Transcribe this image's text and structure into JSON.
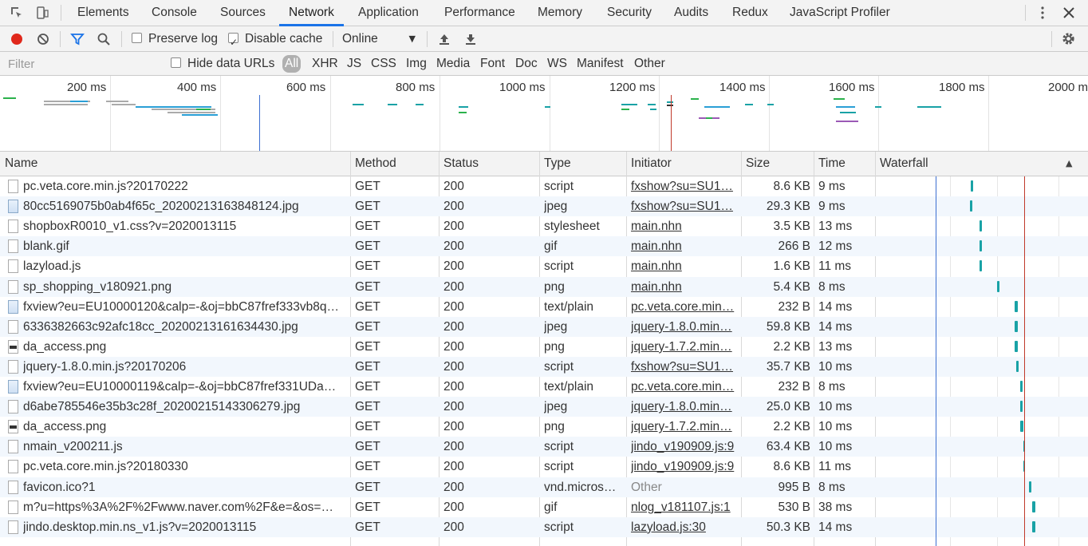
{
  "tabs": [
    "Elements",
    "Console",
    "Sources",
    "Network",
    "Application",
    "Performance",
    "Memory",
    "Security",
    "Audits",
    "Redux",
    "JavaScript Profiler"
  ],
  "active_tab": "Network",
  "toolbar": {
    "preserve_log": "Preserve log",
    "disable_cache": "Disable cache",
    "throttle": "Online",
    "preserve_log_checked": false,
    "disable_cache_checked": true
  },
  "filter": {
    "placeholder": "Filter",
    "hide_data_urls": "Hide data URLs",
    "types": [
      "All",
      "XHR",
      "JS",
      "CSS",
      "Img",
      "Media",
      "Font",
      "Doc",
      "WS",
      "Manifest",
      "Other"
    ],
    "selected_type": "All"
  },
  "overview": {
    "ticks": [
      "200 ms",
      "400 ms",
      "600 ms",
      "800 ms",
      "1000 ms",
      "1200 ms",
      "1400 ms",
      "1600 ms",
      "1800 ms",
      "2000 ms"
    ]
  },
  "columns": {
    "name": "Name",
    "method": "Method",
    "status": "Status",
    "type": "Type",
    "initiator": "Initiator",
    "size": "Size",
    "time": "Time",
    "waterfall": "Waterfall"
  },
  "requests": [
    {
      "name": "pc.veta.core.min.js?20170222",
      "method": "GET",
      "status": "200",
      "type": "script",
      "initiator": "fxshow?su=SU1…",
      "size": "8.6 KB",
      "time": "9 ms",
      "icon": "file"
    },
    {
      "name": "80cc5169075b0ab4f65c_20200213163848124.jpg",
      "method": "GET",
      "status": "200",
      "type": "jpeg",
      "initiator": "fxshow?su=SU1…",
      "size": "29.3 KB",
      "time": "9 ms",
      "icon": "img"
    },
    {
      "name": "shopboxR0010_v1.css?v=2020013115",
      "method": "GET",
      "status": "200",
      "type": "stylesheet",
      "initiator": "main.nhn",
      "size": "3.5 KB",
      "time": "13 ms",
      "icon": "file"
    },
    {
      "name": "blank.gif",
      "method": "GET",
      "status": "200",
      "type": "gif",
      "initiator": "main.nhn",
      "size": "266 B",
      "time": "12 ms",
      "icon": "file"
    },
    {
      "name": "lazyload.js",
      "method": "GET",
      "status": "200",
      "type": "script",
      "initiator": "main.nhn",
      "size": "1.6 KB",
      "time": "11 ms",
      "icon": "file"
    },
    {
      "name": "sp_shopping_v180921.png",
      "method": "GET",
      "status": "200",
      "type": "png",
      "initiator": "main.nhn",
      "size": "5.4 KB",
      "time": "8 ms",
      "icon": "file"
    },
    {
      "name": "fxview?eu=EU10000120&calp=-&oj=bbC87fref333vb8q…",
      "method": "GET",
      "status": "200",
      "type": "text/plain",
      "initiator": "pc.veta.core.min…",
      "size": "232 B",
      "time": "14 ms",
      "icon": "img"
    },
    {
      "name": "6336382663c92afc18cc_20200213161634430.jpg",
      "method": "GET",
      "status": "200",
      "type": "jpeg",
      "initiator": "jquery-1.8.0.min…",
      "size": "59.8 KB",
      "time": "14 ms",
      "icon": "file"
    },
    {
      "name": "da_access.png",
      "method": "GET",
      "status": "200",
      "type": "png",
      "initiator": "jquery-1.7.2.min…",
      "size": "2.2 KB",
      "time": "13 ms",
      "icon": "dark"
    },
    {
      "name": "jquery-1.8.0.min.js?20170206",
      "method": "GET",
      "status": "200",
      "type": "script",
      "initiator": "fxshow?su=SU1…",
      "size": "35.7 KB",
      "time": "10 ms",
      "icon": "file"
    },
    {
      "name": "fxview?eu=EU10000119&calp=-&oj=bbC87fref331UDa…",
      "method": "GET",
      "status": "200",
      "type": "text/plain",
      "initiator": "pc.veta.core.min…",
      "size": "232 B",
      "time": "8 ms",
      "icon": "img"
    },
    {
      "name": "d6abe785546e35b3c28f_20200215143306279.jpg",
      "method": "GET",
      "status": "200",
      "type": "jpeg",
      "initiator": "jquery-1.8.0.min…",
      "size": "25.0 KB",
      "time": "10 ms",
      "icon": "file"
    },
    {
      "name": "da_access.png",
      "method": "GET",
      "status": "200",
      "type": "png",
      "initiator": "jquery-1.7.2.min…",
      "size": "2.2 KB",
      "time": "10 ms",
      "icon": "dark"
    },
    {
      "name": "nmain_v200211.js",
      "method": "GET",
      "status": "200",
      "type": "script",
      "initiator": "jindo_v190909.js:9",
      "size": "63.4 KB",
      "time": "10 ms",
      "icon": "file"
    },
    {
      "name": "pc.veta.core.min.js?20180330",
      "method": "GET",
      "status": "200",
      "type": "script",
      "initiator": "jindo_v190909.js:9",
      "size": "8.6 KB",
      "time": "11 ms",
      "icon": "file"
    },
    {
      "name": "favicon.ico?1",
      "method": "GET",
      "status": "200",
      "type": "vnd.micros…",
      "initiator": "Other",
      "size": "995 B",
      "time": "8 ms",
      "icon": "file"
    },
    {
      "name": "m?u=https%3A%2F%2Fwww.naver.com%2F&e=&os=…",
      "method": "GET",
      "status": "200",
      "type": "gif",
      "initiator": "nlog_v181107.js:1",
      "size": "530 B",
      "time": "38 ms",
      "icon": "file"
    },
    {
      "name": "jindo.desktop.min.ns_v1.js?v=2020013115",
      "method": "GET",
      "status": "200",
      "type": "script",
      "initiator": "lazyload.js:30",
      "size": "50.3 KB",
      "time": "14 ms",
      "icon": "file"
    }
  ],
  "colors": {
    "accent": "#1a73e8",
    "record": "#e0281b",
    "waterfall_bar": "#19a2a6",
    "dom_line": "#3c6fd1",
    "load_line": "#c0392b"
  }
}
